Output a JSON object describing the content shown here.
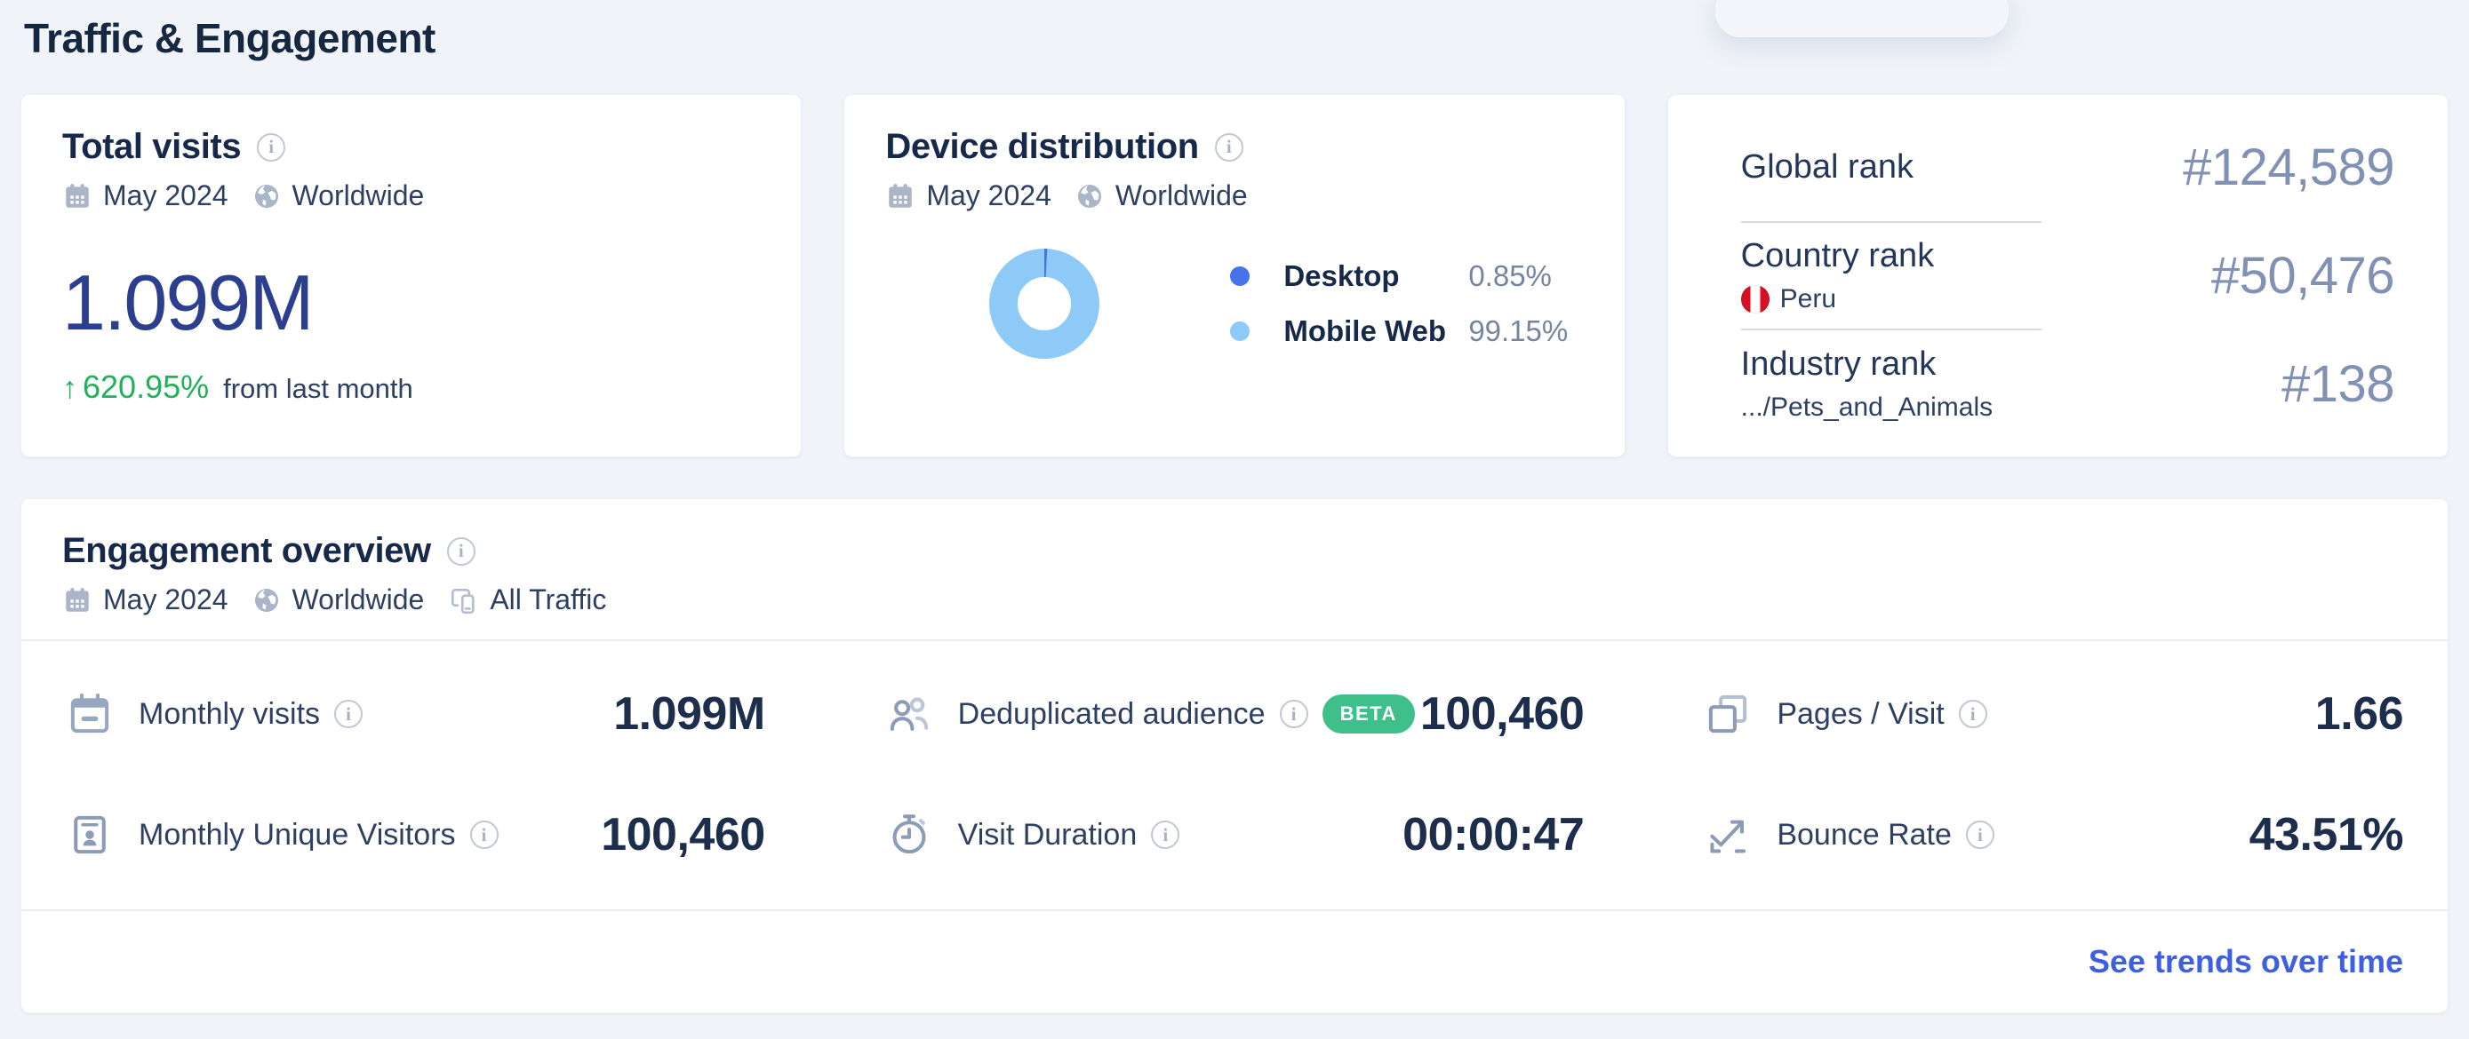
{
  "page": {
    "title": "Traffic & Engagement"
  },
  "icons": {
    "up_arrow": "↑"
  },
  "colors": {
    "positive_green": "#21b15b",
    "link_blue": "#3d5fe0",
    "beta_badge_green": "#3fc08b",
    "big_number_blue": "#2c3e8e",
    "donut_desktop": "#4673ea",
    "donut_mobile": "#8ecaf8",
    "peru_flag_red": "#d91023"
  },
  "cards": {
    "total_visits": {
      "title": "Total visits",
      "period": "May 2024",
      "region": "Worldwide",
      "value": "1.099M",
      "change": "620.95%",
      "change_direction": "up",
      "change_suffix": "from last month"
    },
    "device_distribution": {
      "title": "Device distribution",
      "period": "May 2024",
      "region": "Worldwide",
      "legend": [
        {
          "label": "Desktop",
          "value": "0.85%",
          "color": "#4673ea"
        },
        {
          "label": "Mobile Web",
          "value": "99.15%",
          "color": "#8ecaf8"
        }
      ]
    },
    "ranks": {
      "rows": [
        {
          "label": "Global rank",
          "value": "#124,589"
        },
        {
          "label": "Country rank",
          "sublabel": "Peru",
          "value": "#50,476"
        },
        {
          "label": "Industry rank",
          "sublabel": ".../Pets_and_Animals",
          "value": "#138"
        }
      ]
    },
    "engagement": {
      "title": "Engagement overview",
      "period": "May 2024",
      "region": "Worldwide",
      "traffic_filter": "All Traffic",
      "metrics": [
        {
          "icon": "calendar-minus-icon",
          "label": "Monthly visits",
          "value": "1.099M"
        },
        {
          "icon": "users-icon",
          "label": "Deduplicated audience",
          "badge": "BETA",
          "value": "100,460"
        },
        {
          "icon": "pages-icon",
          "label": "Pages / Visit",
          "value": "1.66"
        },
        {
          "icon": "id-card-icon",
          "label": "Monthly Unique Visitors",
          "value": "100,460"
        },
        {
          "icon": "stopwatch-icon",
          "label": "Visit Duration",
          "value": "00:00:47"
        },
        {
          "icon": "bounce-arrow-icon",
          "label": "Bounce Rate",
          "value": "43.51%"
        }
      ],
      "footer_link": "See trends over time"
    }
  },
  "chart_data": {
    "type": "pie",
    "title": "Device distribution",
    "categories": [
      "Desktop",
      "Mobile Web"
    ],
    "values": [
      0.85,
      99.15
    ],
    "unit": "%",
    "colors": [
      "#4673ea",
      "#8ecaf8"
    ],
    "legend_position": "right",
    "donut": true
  }
}
